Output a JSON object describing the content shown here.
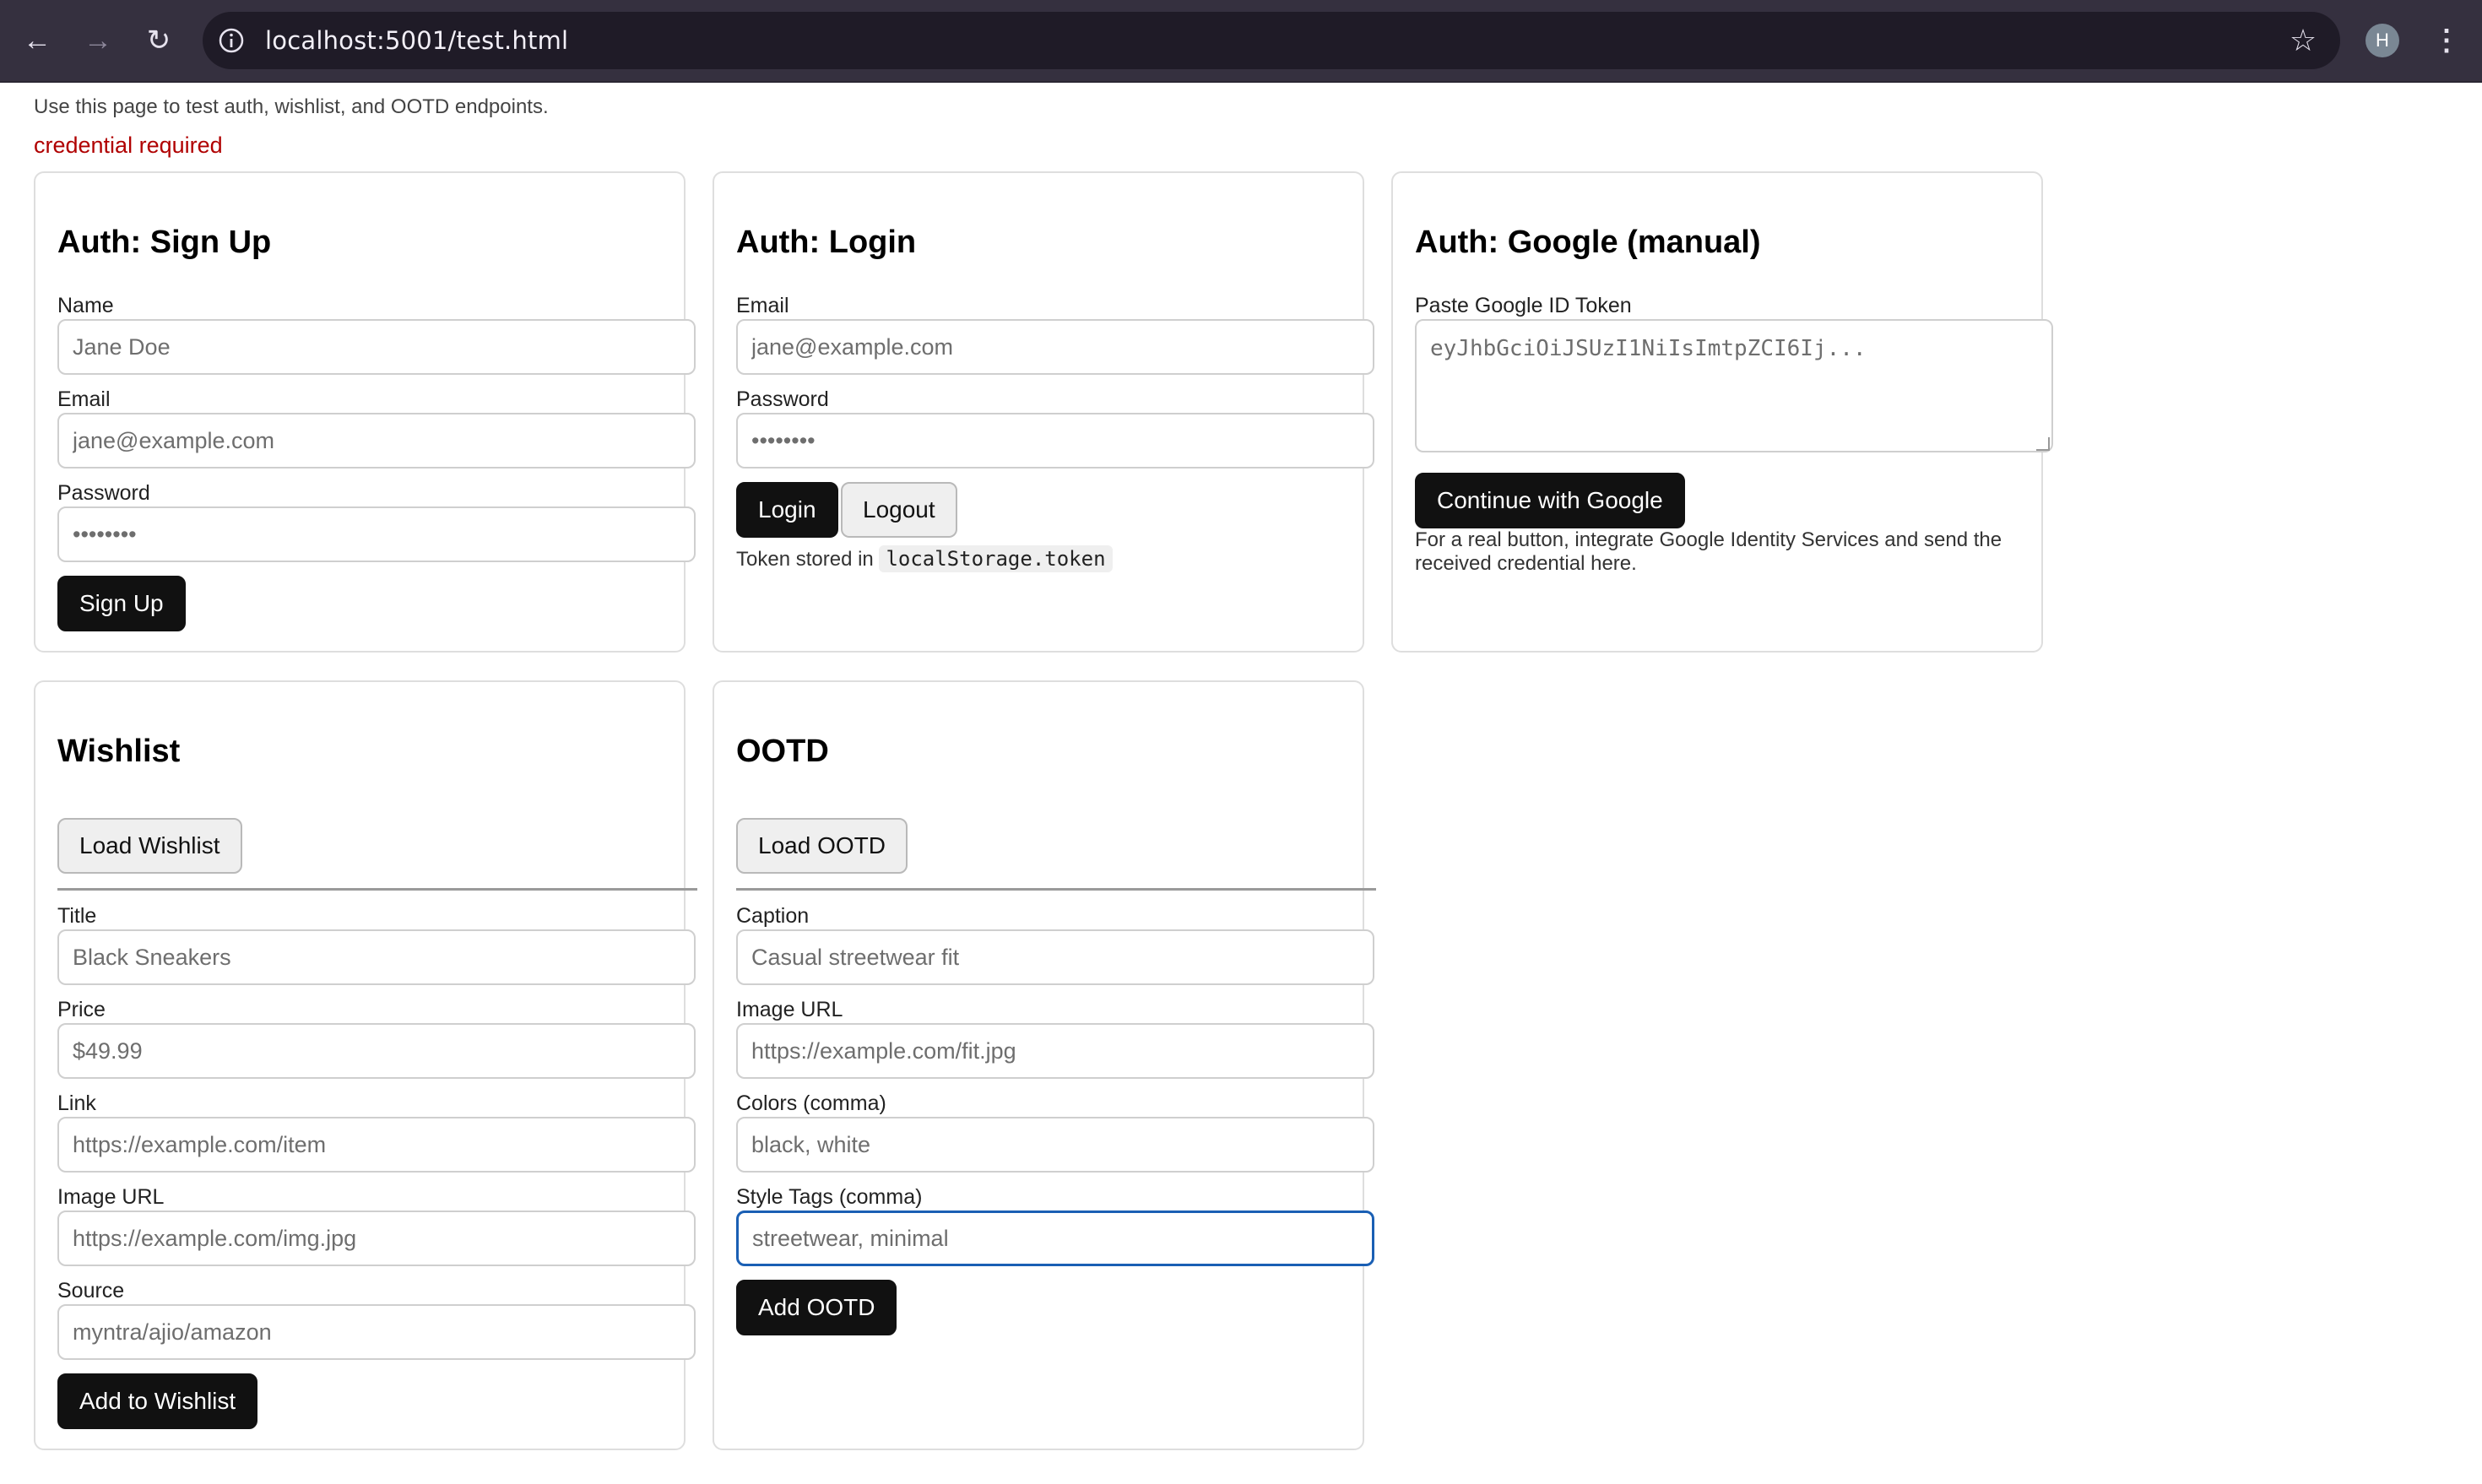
{
  "browser": {
    "url": "localhost:5001/test.html",
    "avatar_letter": "H"
  },
  "page": {
    "intro": "Use this page to test auth, wishlist, and OOTD endpoints.",
    "error": "credential required"
  },
  "signup": {
    "title": "Auth: Sign Up",
    "name_label": "Name",
    "name_placeholder": "Jane Doe",
    "email_label": "Email",
    "email_placeholder": "jane@example.com",
    "password_label": "Password",
    "password_placeholder": "••••••••",
    "button": "Sign Up"
  },
  "login": {
    "title": "Auth: Login",
    "email_label": "Email",
    "email_placeholder": "jane@example.com",
    "password_label": "Password",
    "password_placeholder": "••••••••",
    "login_button": "Login",
    "logout_button": "Logout",
    "token_note": "Token stored in",
    "token_key": "localStorage.token"
  },
  "google": {
    "title": "Auth: Google (manual)",
    "token_label": "Paste Google ID Token",
    "token_placeholder": "eyJhbGciOiJSUzI1NiIsImtpZCI6Ij...",
    "button": "Continue with Google",
    "note": "For a real button, integrate Google Identity Services and send the received credential here."
  },
  "wishlist": {
    "title": "Wishlist",
    "load_button": "Load Wishlist",
    "title_label": "Title",
    "title_placeholder": "Black Sneakers",
    "price_label": "Price",
    "price_placeholder": "$49.99",
    "link_label": "Link",
    "link_placeholder": "https://example.com/item",
    "image_label": "Image URL",
    "image_placeholder": "https://example.com/img.jpg",
    "source_label": "Source",
    "source_placeholder": "myntra/ajio/amazon",
    "add_button": "Add to Wishlist"
  },
  "ootd": {
    "title": "OOTD",
    "load_button": "Load OOTD",
    "caption_label": "Caption",
    "caption_placeholder": "Casual streetwear fit",
    "image_label": "Image URL",
    "image_placeholder": "https://example.com/fit.jpg",
    "colors_label": "Colors (comma)",
    "colors_placeholder": "black, white",
    "tags_label": "Style Tags (comma)",
    "tags_placeholder": "streetwear, minimal",
    "add_button": "Add OOTD"
  }
}
